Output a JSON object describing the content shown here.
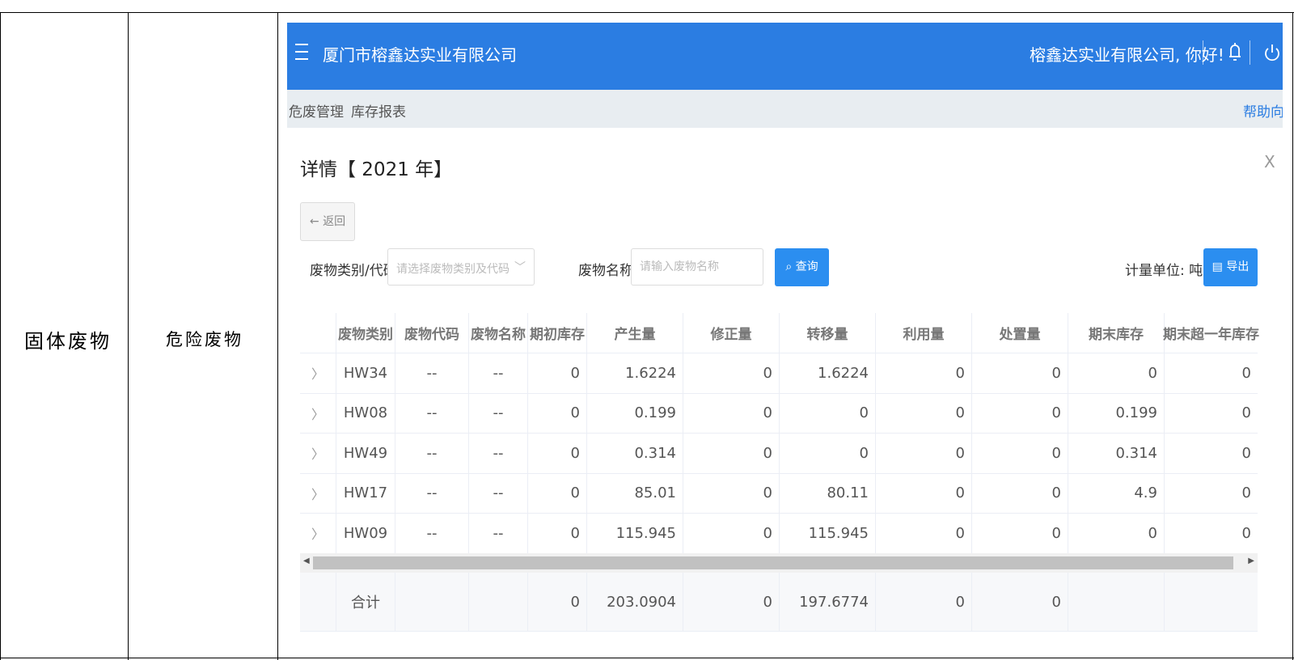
{
  "document": {
    "category": "固体废物",
    "subcategory": "危险废物"
  },
  "app": {
    "company_name": "厦门市榕鑫达实业有限公司",
    "greeting": "榕鑫达实业有限公司, 你好!",
    "accent_color": "#2b7de2"
  },
  "breadcrumb": {
    "items": [
      "危废管理",
      "库存报表"
    ],
    "separator": "〉",
    "help": "帮助向导"
  },
  "detail": {
    "title": "详情【 2021 年】",
    "close": "X",
    "back_label": "← 返回"
  },
  "filters": {
    "category_label": "废物类别/代码",
    "category_placeholder": "请选择废物类别及代码",
    "name_label": "废物名称",
    "name_placeholder": "请输入废物名称",
    "query_label": "查询",
    "unit_label": "计量单位: 吨",
    "export_label": "导出"
  },
  "table": {
    "headers": [
      "",
      "废物类别",
      "废物代码",
      "废物名称",
      "期初库存",
      "产生量",
      "修正量",
      "转移量",
      "利用量",
      "处置量",
      "期末库存",
      "期末超一年库存"
    ],
    "rows": [
      [
        "〉",
        "HW34",
        "--",
        "--",
        "0",
        "1.6224",
        "0",
        "1.6224",
        "0",
        "0",
        "0",
        "0"
      ],
      [
        "〉",
        "HW08",
        "--",
        "--",
        "0",
        "0.199",
        "0",
        "0",
        "0",
        "0",
        "0.199",
        "0"
      ],
      [
        "〉",
        "HW49",
        "--",
        "--",
        "0",
        "0.314",
        "0",
        "0",
        "0",
        "0",
        "0.314",
        "0"
      ],
      [
        "〉",
        "HW17",
        "--",
        "--",
        "0",
        "85.01",
        "0",
        "80.11",
        "0",
        "0",
        "4.9",
        "0"
      ],
      [
        "〉",
        "HW09",
        "--",
        "--",
        "0",
        "115.945",
        "0",
        "115.945",
        "0",
        "0",
        "0",
        "0"
      ]
    ],
    "footer": [
      "",
      "合计",
      "",
      "",
      "0",
      "203.0904",
      "0",
      "197.6774",
      "0",
      "0",
      "",
      ""
    ]
  }
}
